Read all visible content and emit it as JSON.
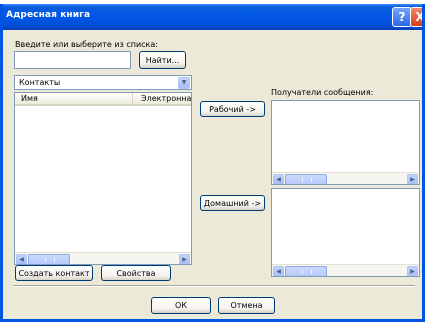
{
  "window": {
    "title": "Адресная книга",
    "help_glyph": "?",
    "close_glyph": "X"
  },
  "search": {
    "label": "Введите или выберите из списка:",
    "value": "",
    "find_button": "Найти..."
  },
  "contacts": {
    "selected": "Контакты",
    "columns": [
      "Имя",
      "Электронная"
    ]
  },
  "actions": {
    "to_button": "Рабочий ->",
    "cc_button": "Домашний ->"
  },
  "recipients": {
    "label": "Получатели сообщения:"
  },
  "bottom": {
    "new_contact": "Создать контакт",
    "properties": "Свойства",
    "ok": "ОК",
    "cancel": "Отмена"
  },
  "icons": {
    "dropdown": "chevron-down-icon",
    "left": "arrow-left-icon",
    "right": "arrow-right-icon"
  },
  "colors": {
    "titlebar": "#0058e6",
    "window_bg": "#ece9d8",
    "border": "#7f9db9"
  }
}
